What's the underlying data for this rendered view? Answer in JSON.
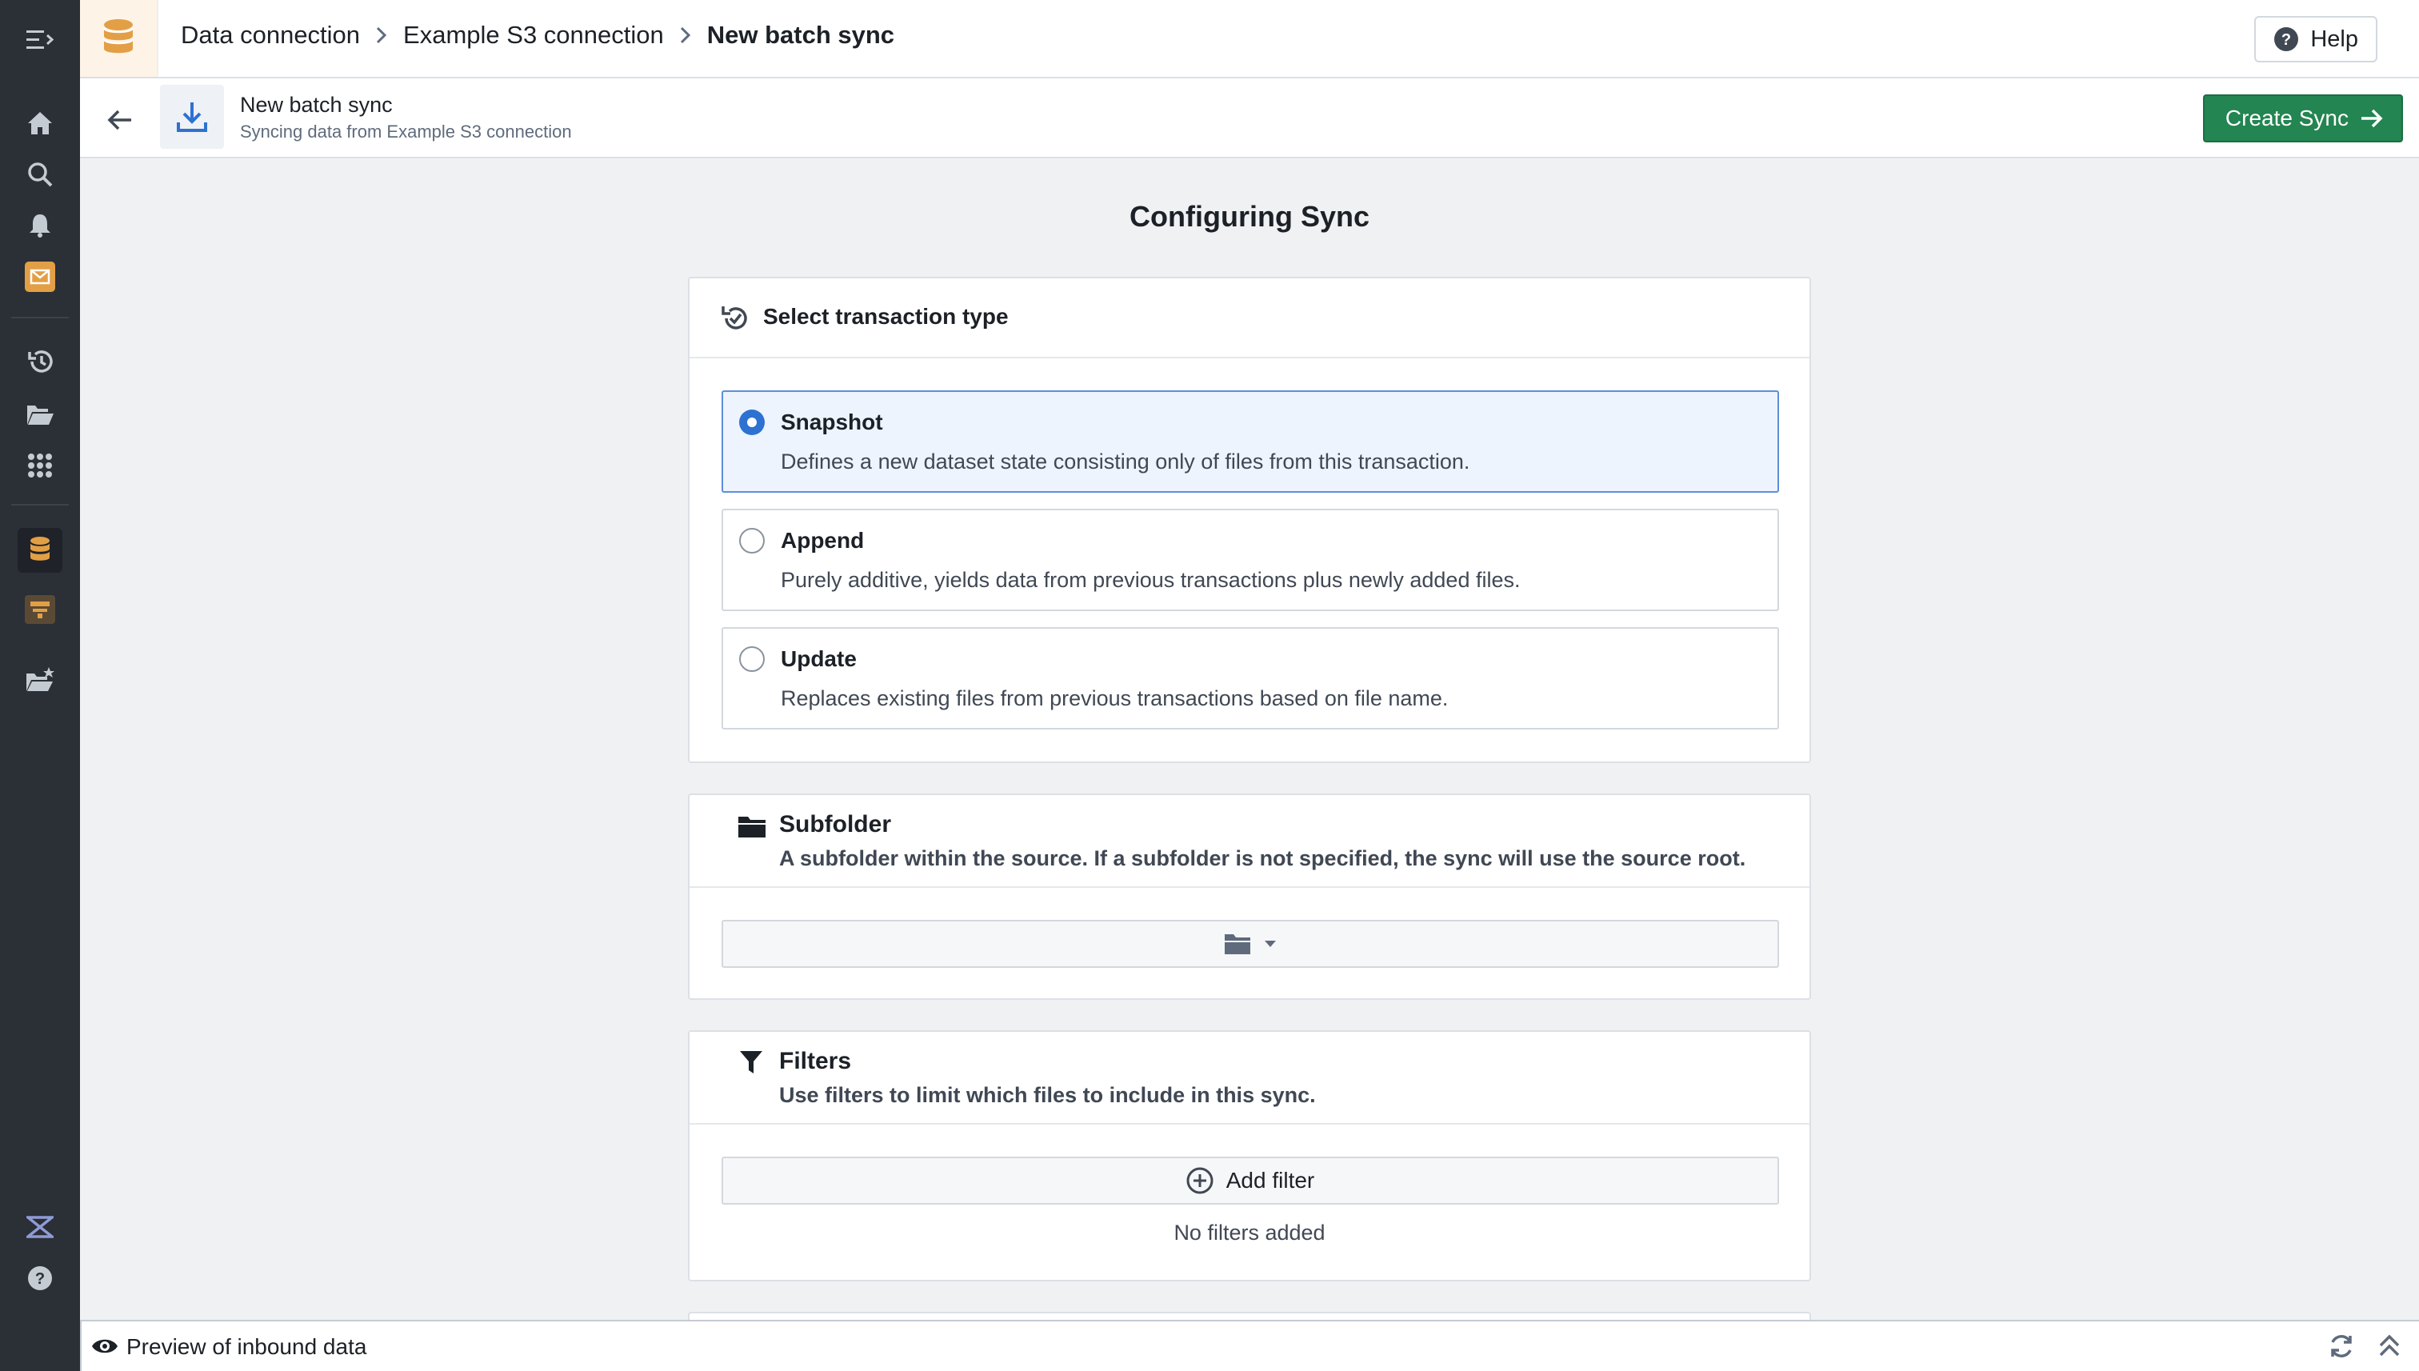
{
  "breadcrumbs": {
    "items": [
      "Data connection",
      "Example S3 connection"
    ],
    "current": "New batch sync"
  },
  "help": {
    "label": "Help"
  },
  "header": {
    "title": "New batch sync",
    "subtitle": "Syncing data from Example S3 connection",
    "create_label": "Create Sync"
  },
  "page": {
    "title": "Configuring Sync"
  },
  "transaction": {
    "title": "Select transaction type",
    "selected": "Snapshot",
    "options": [
      {
        "label": "Snapshot",
        "desc": "Defines a new dataset state consisting only of files from this transaction."
      },
      {
        "label": "Append",
        "desc": "Purely additive, yields data from previous transactions plus newly added files."
      },
      {
        "label": "Update",
        "desc": "Replaces existing files from previous transactions based on file name."
      }
    ]
  },
  "subfolder": {
    "title": "Subfolder",
    "desc": "A subfolder within the source. If a subfolder is not specified, the sync will use the source root."
  },
  "filters": {
    "title": "Filters",
    "desc": "Use filters to limit which files to include in this sync.",
    "add_label": "Add filter",
    "empty_text": "No filters added"
  },
  "preview": {
    "label": "Preview of inbound data"
  },
  "colors": {
    "rail": "#2b2f36",
    "accent_orange": "#e39f45",
    "primary_green": "#238551",
    "selected_blue": "#2d72d2",
    "selected_bg": "#edf4fe"
  },
  "icons": {
    "rail": [
      "menu-icon",
      "home-icon",
      "search-icon",
      "bell-icon",
      "mail-icon",
      "history-icon",
      "folder-open-icon",
      "apps-grid-icon",
      "database-icon",
      "pipeline-icon",
      "folder-star-icon",
      "product-logo-icon",
      "help-circle-icon"
    ]
  }
}
